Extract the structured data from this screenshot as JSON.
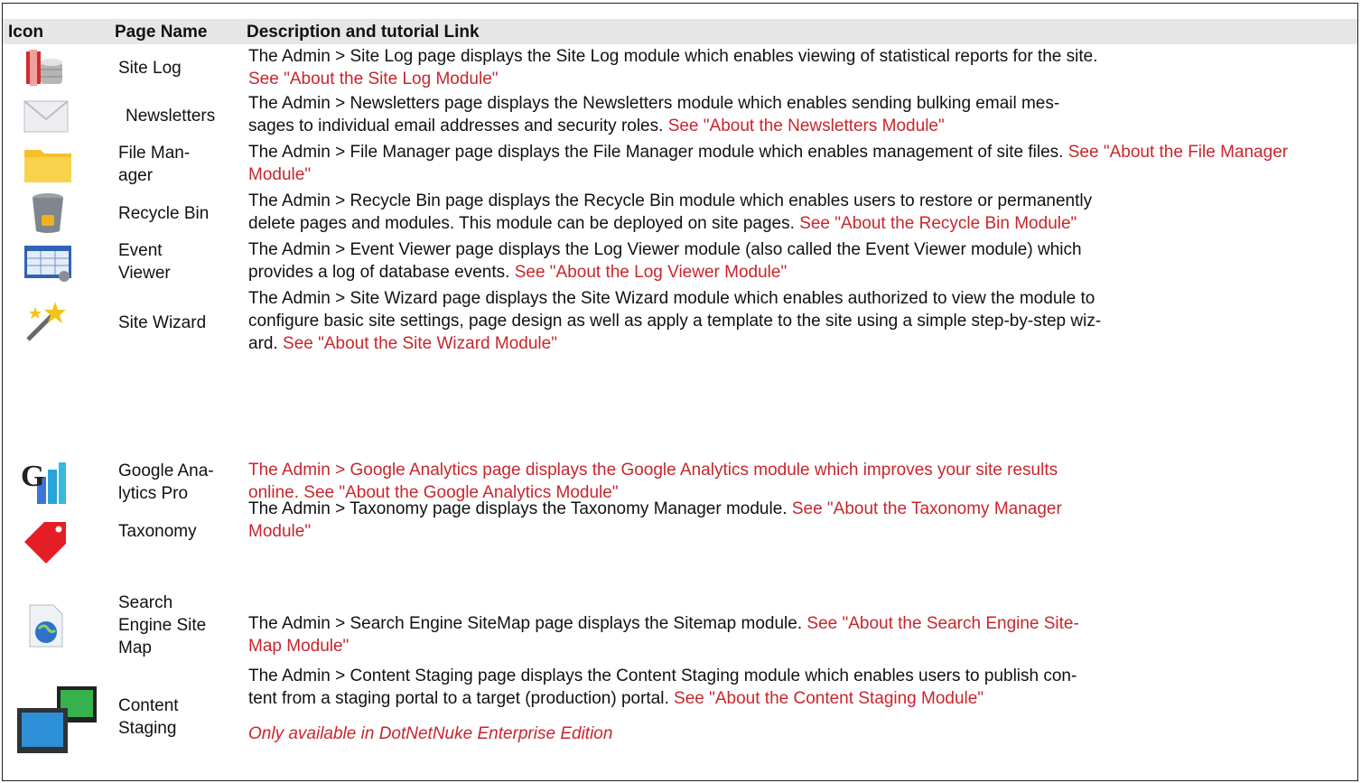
{
  "header": {
    "icon": "Icon",
    "page_name": "Page Name",
    "description": "Description and tutorial Link"
  },
  "rows": [
    {
      "icon": "site-log-database-icon",
      "name": "Site Log",
      "lines": [
        "The Admin > Site Log page displays the Site Log module which enables viewing of statistical reports for the site."
      ],
      "link": "See \"About the Site Log Module\""
    },
    {
      "icon": "envelope-icon",
      "name": "Newsletters",
      "lines": [
        "The Admin > Newsletters page displays the Newsletters module which enables sending bulking email mes-",
        "sages to individual email addresses and security roles. "
      ],
      "link": "See \"About the Newsletters Module\""
    },
    {
      "icon": "folder-icon",
      "name": "File Man-\nager",
      "lines": [
        "The Admin > File Manager page displays the File Manager module which enables management of site files. "
      ],
      "link": "See \"About the File Manager Module\""
    },
    {
      "icon": "recycle-bin-icon",
      "name": "Recycle Bin",
      "lines": [
        "The Admin > Recycle Bin page displays the Recycle Bin module which enables users to restore or permanently",
        "delete pages and modules. This module can be deployed on site pages. "
      ],
      "link": "See \"About the Recycle Bin Module\""
    },
    {
      "icon": "event-viewer-grid-icon",
      "name": "Event\nViewer",
      "lines": [
        "The Admin > Event Viewer page displays the Log Viewer module (also called the Event Viewer module) which",
        "provides a log of database events. "
      ],
      "link": "See \"About the Log Viewer Module\""
    },
    {
      "icon": "magic-wand-icon",
      "name": "Site Wizard",
      "lines": [
        "The Admin > Site Wizard page displays the Site Wizard module which enables authorized to view the module to",
        "configure basic site settings, page design as well as apply a template to the site using a simple step-by-step wiz-",
        "ard. "
      ],
      "link": "See \"About the Site Wizard Module\""
    },
    {
      "icon": "google-analytics-icon",
      "name": "Google Ana-\nlytics Pro",
      "red_text": "The Admin > Google Analytics page displays the Google Analytics module which improves your site results\nonline. See \"About the Google Analytics Module\""
    },
    {
      "icon": "tag-icon",
      "name": "Taxonomy",
      "lines": [
        "The Admin > Taxonomy page displays the Taxonomy Manager module. "
      ],
      "link": "See \"About the Taxonomy Manager Module\""
    },
    {
      "icon": "sitemap-globe-icon",
      "name": "Search\nEngine Site\nMap",
      "lines": [
        "The Admin > Search Engine SiteMap page displays the Sitemap module. "
      ],
      "link": "See \"About the Search Engine Site-Map Module\""
    },
    {
      "icon": "monitors-icon",
      "name": "Content\nStaging",
      "lines": [
        "The Admin > Content Staging page displays the Content Staging module which enables users to publish con-",
        "tent from a staging portal to a target (production) portal. "
      ],
      "link": "See \"About the Content Staging Module\"",
      "note": "Only available in DotNetNuke Enterprise Edition"
    }
  ],
  "colors": {
    "header_bg": "#e6e6e6",
    "link": "#c8262d",
    "border": "#222222"
  }
}
